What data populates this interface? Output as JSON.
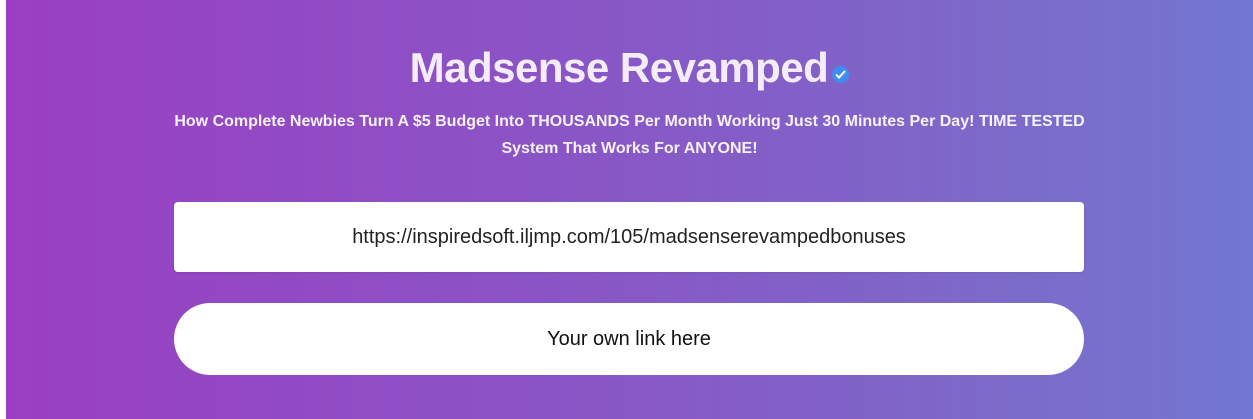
{
  "header": {
    "title": "Madsense Revamped",
    "verified_icon": "verified-badge-icon",
    "subtitle": "How Complete Newbies Turn A $5 Budget Into THOUSANDS Per Month Working Just 30 Minutes Per Day! TIME TESTED System That Works For ANYONE!"
  },
  "link_field": {
    "value": "https://inspiredsoft.iljmp.com/105/madsenserevampedbonuses"
  },
  "cta": {
    "label": "Your own link here"
  },
  "colors": {
    "gradient_start": "#9a3fc2",
    "gradient_end": "#7277d1",
    "verified_badge": "#3d8ef0"
  }
}
